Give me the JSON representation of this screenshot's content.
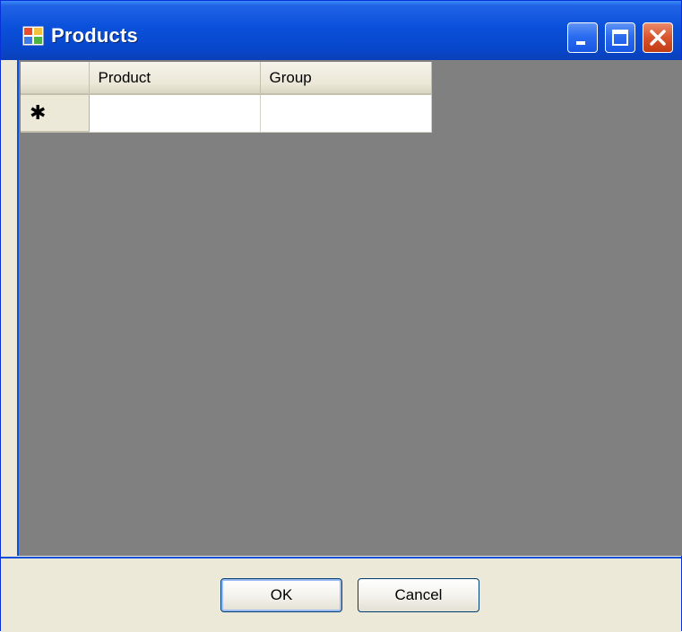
{
  "window": {
    "title": "Products",
    "icons": {
      "app": "window-app-icon",
      "minimize": "minimize-icon",
      "maximize": "maximize-icon",
      "close": "close-icon"
    }
  },
  "grid": {
    "columns": [
      "Product",
      "Group"
    ],
    "new_row_marker": "✱",
    "rows": [
      {
        "product": "",
        "group": ""
      }
    ]
  },
  "buttons": {
    "ok": "OK",
    "cancel": "Cancel"
  },
  "colors": {
    "titlebar": "#0a50da",
    "client_background": "#808080",
    "dialog_background": "#ece9d8",
    "close_button": "#d8542c"
  }
}
